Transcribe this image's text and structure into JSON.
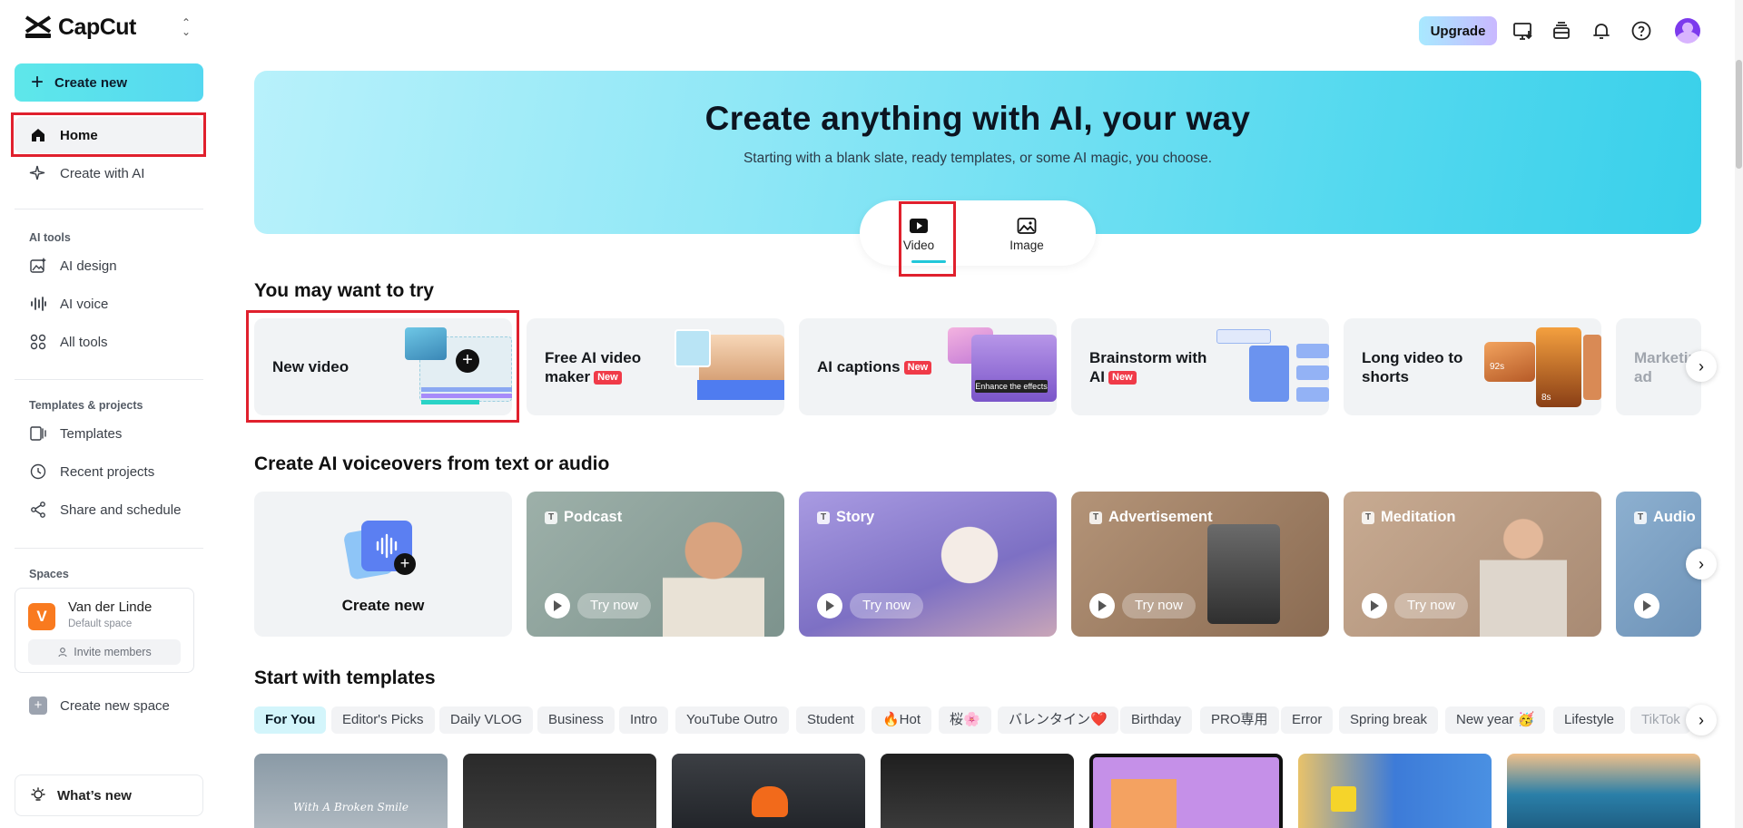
{
  "app": {
    "name": "CapCut"
  },
  "sidebar": {
    "create_label": "Create new",
    "home_label": "Home",
    "create_ai_label": "Create with AI",
    "ai_tools_label": "AI tools",
    "ai_design_label": "AI design",
    "ai_voice_label": "AI voice",
    "all_tools_label": "All tools",
    "templates_projects_label": "Templates & projects",
    "templates_label": "Templates",
    "recent_label": "Recent projects",
    "share_label": "Share and schedule",
    "spaces_label": "Spaces",
    "space": {
      "initial": "V",
      "name": "Van der Linde",
      "sub": "Default space",
      "invite_label": "Invite members"
    },
    "new_space_label": "Create new space",
    "whats_new_label": "What’s new"
  },
  "header": {
    "upgrade_label": "Upgrade"
  },
  "hero": {
    "title": "Create anything with AI, your way",
    "subtitle": "Starting with a blank slate, ready templates, or some AI magic, you choose.",
    "tabs": [
      {
        "label": "Video"
      },
      {
        "label": "Image"
      }
    ]
  },
  "try_section": {
    "title": "You may want to try",
    "cards": [
      {
        "label": "New video",
        "badge": ""
      },
      {
        "label": "Free AI video maker",
        "badge": "New"
      },
      {
        "label": "AI captions",
        "badge": "New"
      },
      {
        "label": "Brainstorm with AI",
        "badge": "New"
      },
      {
        "label": "Long video to shorts",
        "badge": ""
      },
      {
        "label": "Marketing video ad",
        "badge": ""
      }
    ],
    "captions_overlay": "Enhance the effects",
    "shorts_badge_1": "92s",
    "shorts_badge_2": "8s"
  },
  "voice_section": {
    "title": "Create AI voiceovers from text or audio",
    "create_label": "Create new",
    "try_label": "Try now",
    "cards": [
      {
        "title": "Podcast",
        "color": "#8fa59f"
      },
      {
        "title": "Story",
        "color": "#9b8fd6"
      },
      {
        "title": "Advertisement",
        "color": "#a88a70"
      },
      {
        "title": "Meditation",
        "color": "#c4a88f"
      },
      {
        "title": "Audio",
        "color": "#7fa3c4"
      }
    ]
  },
  "templates_section": {
    "title": "Start with templates",
    "chips": [
      "For You",
      "Editor's Picks",
      "Daily VLOG",
      "Business",
      "Intro",
      "YouTube Outro",
      "Student",
      "🔥Hot",
      "桜🌸",
      "バレンタイン❤️",
      "Birthday",
      "PRO専用",
      "Error",
      "Spring break",
      "New year 🥳",
      "Lifestyle",
      "TikTok"
    ],
    "tpl_caption": "With A Broken Smile"
  }
}
